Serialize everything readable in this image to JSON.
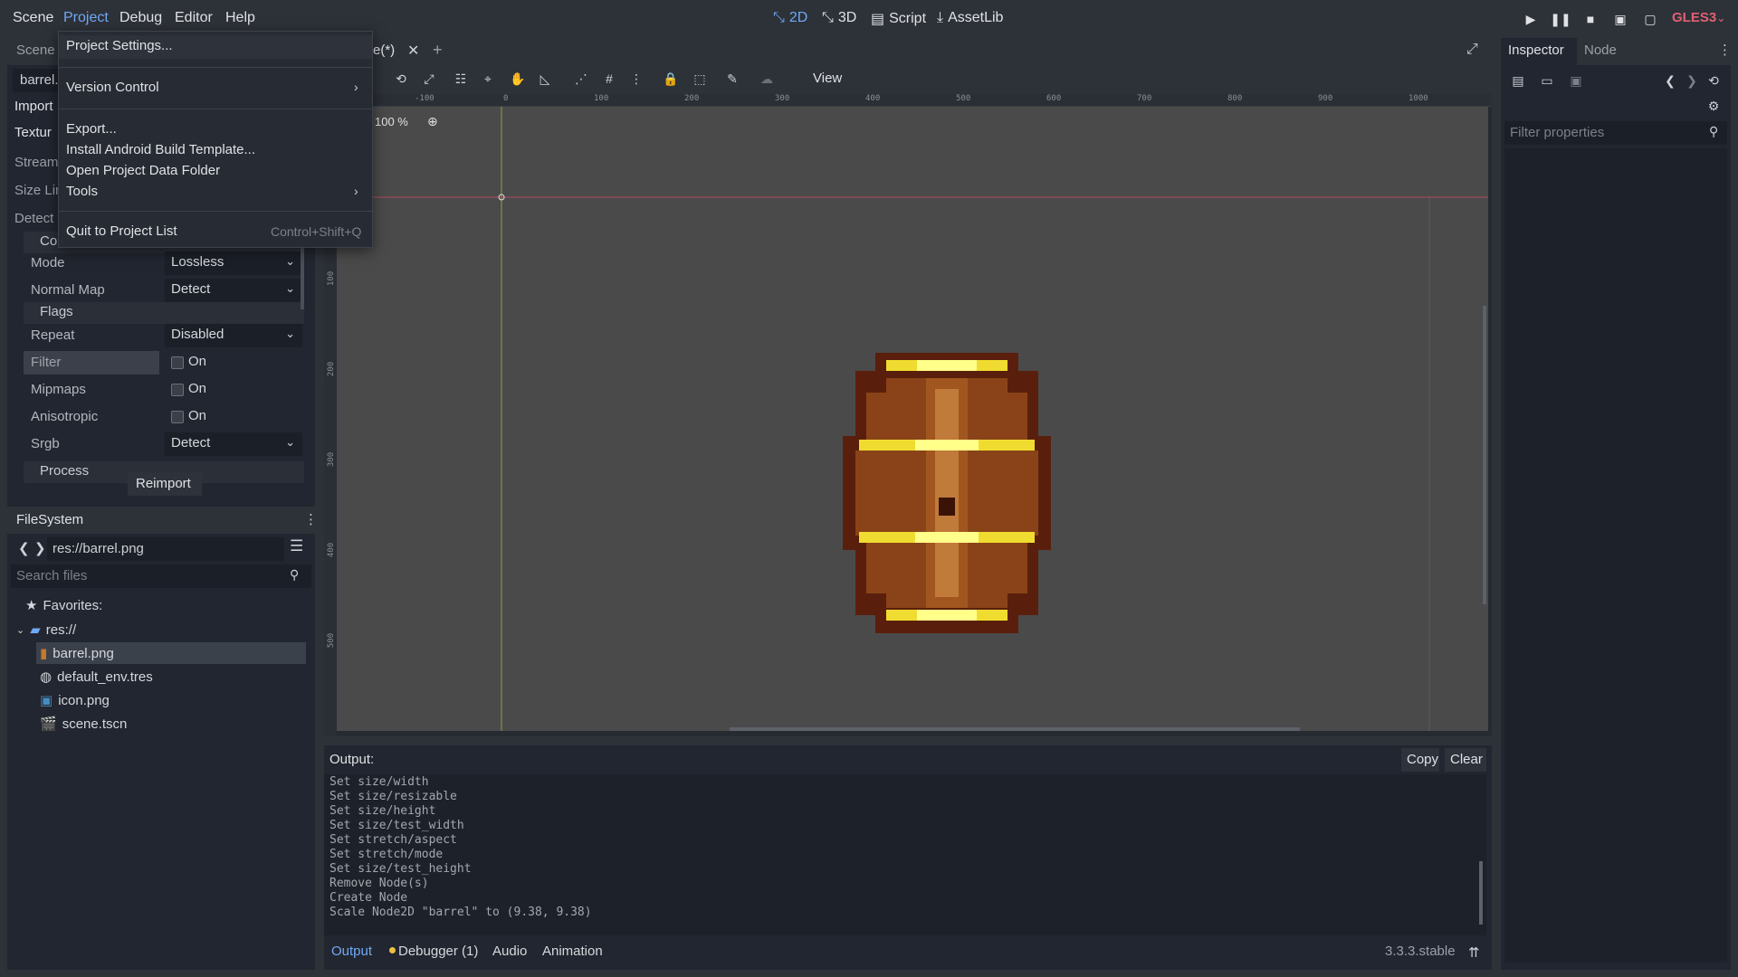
{
  "menubar": {
    "items": [
      "Scene",
      "Project",
      "Debug",
      "Editor",
      "Help"
    ],
    "modes": [
      "2D",
      "3D",
      "Script",
      "AssetLib"
    ],
    "renderer": "GLES3"
  },
  "left_dock": {
    "tabs": [
      "Scene",
      "Import"
    ],
    "file_name": "barrel.",
    "import_tab": "Import",
    "texture_label": "Textur",
    "stream_label": "Stream",
    "size_limit_label": "Size Lir",
    "detect_label": "Detect",
    "compress_section": "Com",
    "props": [
      {
        "label": "Mode",
        "value": "Lossless"
      },
      {
        "label": "Normal Map",
        "value": "Detect"
      }
    ],
    "flags_section": "Flags",
    "flags": [
      {
        "label": "Repeat",
        "value": "Disabled",
        "type": "select"
      },
      {
        "label": "Filter",
        "value": "On",
        "type": "check"
      },
      {
        "label": "Mipmaps",
        "value": "On",
        "type": "check"
      },
      {
        "label": "Anisotropic",
        "value": "On",
        "type": "check"
      },
      {
        "label": "Srgb",
        "value": "Detect",
        "type": "select"
      }
    ],
    "process_section": "Process",
    "reimport": "Reimport"
  },
  "filesystem": {
    "title": "FileSystem",
    "path": "res://barrel.png",
    "search_placeholder": "Search files",
    "favorites": "Favorites:",
    "root": "res://",
    "files": [
      "barrel.png",
      "default_env.tres",
      "icon.png",
      "scene.tscn"
    ]
  },
  "scene_tabs": {
    "active": "e(*)"
  },
  "toolbar": {
    "view": "View"
  },
  "viewport": {
    "zoom": "100 %",
    "ruler_top": [
      "-100",
      "0",
      "100",
      "200",
      "300",
      "400",
      "500",
      "600",
      "700",
      "800",
      "900",
      "1000"
    ],
    "ruler_left": [
      "100",
      "200",
      "300",
      "400",
      "500"
    ]
  },
  "project_menu": {
    "items": [
      {
        "label": "Project Settings..."
      },
      {
        "label": "Version Control",
        "submenu": true
      },
      {
        "label": "Export..."
      },
      {
        "label": "Install Android Build Template..."
      },
      {
        "label": "Open Project Data Folder"
      },
      {
        "label": "Tools",
        "submenu": true
      },
      {
        "label": "Quit to Project List",
        "shortcut": "Control+Shift+Q"
      }
    ]
  },
  "output": {
    "title": "Output:",
    "copy": "Copy",
    "clear": "Clear",
    "lines": [
      "Set size/width",
      "Set size/resizable",
      "Set size/height",
      "Set size/test_width",
      "Set stretch/aspect",
      "Set stretch/mode",
      "Set size/test_height",
      "Remove Node(s)",
      "Create Node",
      "Scale Node2D \"barrel\" to (9.38, 9.38)"
    ],
    "tabs": [
      "Output",
      "Debugger (1)",
      "Audio",
      "Animation"
    ],
    "version": "3.3.3.stable"
  },
  "inspector": {
    "tabs": [
      "Inspector",
      "Node"
    ],
    "filter_placeholder": "Filter properties"
  },
  "colors": {
    "accent": "#6fa9f5",
    "renderer": "#e16074"
  }
}
